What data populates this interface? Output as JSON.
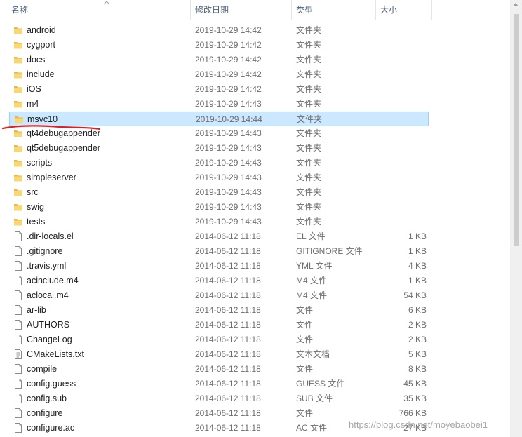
{
  "columns": {
    "name": "名称",
    "date": "修改日期",
    "type": "类型",
    "size": "大小"
  },
  "selected_index": 6,
  "files": [
    {
      "name": "android",
      "date": "2019-10-29 14:42",
      "type": "文件夹",
      "size": "",
      "icon": "folder-icon"
    },
    {
      "name": "cygport",
      "date": "2019-10-29 14:42",
      "type": "文件夹",
      "size": "",
      "icon": "folder-icon"
    },
    {
      "name": "docs",
      "date": "2019-10-29 14:42",
      "type": "文件夹",
      "size": "",
      "icon": "folder-icon"
    },
    {
      "name": "include",
      "date": "2019-10-29 14:42",
      "type": "文件夹",
      "size": "",
      "icon": "folder-icon"
    },
    {
      "name": "iOS",
      "date": "2019-10-29 14:42",
      "type": "文件夹",
      "size": "",
      "icon": "folder-icon"
    },
    {
      "name": "m4",
      "date": "2019-10-29 14:43",
      "type": "文件夹",
      "size": "",
      "icon": "folder-icon"
    },
    {
      "name": "msvc10",
      "date": "2019-10-29 14:44",
      "type": "文件夹",
      "size": "",
      "icon": "folder-icon"
    },
    {
      "name": "qt4debugappender",
      "date": "2019-10-29 14:43",
      "type": "文件夹",
      "size": "",
      "icon": "folder-icon"
    },
    {
      "name": "qt5debugappender",
      "date": "2019-10-29 14:43",
      "type": "文件夹",
      "size": "",
      "icon": "folder-icon"
    },
    {
      "name": "scripts",
      "date": "2019-10-29 14:43",
      "type": "文件夹",
      "size": "",
      "icon": "folder-icon"
    },
    {
      "name": "simpleserver",
      "date": "2019-10-29 14:43",
      "type": "文件夹",
      "size": "",
      "icon": "folder-icon"
    },
    {
      "name": "src",
      "date": "2019-10-29 14:43",
      "type": "文件夹",
      "size": "",
      "icon": "folder-icon"
    },
    {
      "name": "swig",
      "date": "2019-10-29 14:43",
      "type": "文件夹",
      "size": "",
      "icon": "folder-icon"
    },
    {
      "name": "tests",
      "date": "2019-10-29 14:43",
      "type": "文件夹",
      "size": "",
      "icon": "folder-icon"
    },
    {
      "name": ".dir-locals.el",
      "date": "2014-06-12 11:18",
      "type": "EL 文件",
      "size": "1 KB",
      "icon": "file-icon"
    },
    {
      "name": ".gitignore",
      "date": "2014-06-12 11:18",
      "type": "GITIGNORE 文件",
      "size": "1 KB",
      "icon": "file-icon"
    },
    {
      "name": ".travis.yml",
      "date": "2014-06-12 11:18",
      "type": "YML 文件",
      "size": "4 KB",
      "icon": "file-icon"
    },
    {
      "name": "acinclude.m4",
      "date": "2014-06-12 11:18",
      "type": "M4 文件",
      "size": "1 KB",
      "icon": "file-icon"
    },
    {
      "name": "aclocal.m4",
      "date": "2014-06-12 11:18",
      "type": "M4 文件",
      "size": "54 KB",
      "icon": "file-icon"
    },
    {
      "name": "ar-lib",
      "date": "2014-06-12 11:18",
      "type": "文件",
      "size": "6 KB",
      "icon": "file-icon"
    },
    {
      "name": "AUTHORS",
      "date": "2014-06-12 11:18",
      "type": "文件",
      "size": "2 KB",
      "icon": "file-icon"
    },
    {
      "name": "ChangeLog",
      "date": "2014-06-12 11:18",
      "type": "文件",
      "size": "2 KB",
      "icon": "file-icon"
    },
    {
      "name": "CMakeLists.txt",
      "date": "2014-06-12 11:18",
      "type": "文本文档",
      "size": "5 KB",
      "icon": "text-file-icon"
    },
    {
      "name": "compile",
      "date": "2014-06-12 11:18",
      "type": "文件",
      "size": "8 KB",
      "icon": "file-icon"
    },
    {
      "name": "config.guess",
      "date": "2014-06-12 11:18",
      "type": "GUESS 文件",
      "size": "45 KB",
      "icon": "file-icon"
    },
    {
      "name": "config.sub",
      "date": "2014-06-12 11:18",
      "type": "SUB 文件",
      "size": "35 KB",
      "icon": "file-icon"
    },
    {
      "name": "configure",
      "date": "2014-06-12 11:18",
      "type": "文件",
      "size": "766 KB",
      "icon": "file-icon"
    },
    {
      "name": "configure.ac",
      "date": "2014-06-12 11:18",
      "type": "AC 文件",
      "size": "27 KB",
      "icon": "file-icon"
    }
  ],
  "watermark": "https://blog.csdn.net/moyebaobei1",
  "colors": {
    "folder": "#f8d775",
    "folder_dark": "#e8b84a",
    "selection_bg": "#cce8ff",
    "selection_border": "#99d1ff",
    "annotation_red": "#e02020"
  }
}
